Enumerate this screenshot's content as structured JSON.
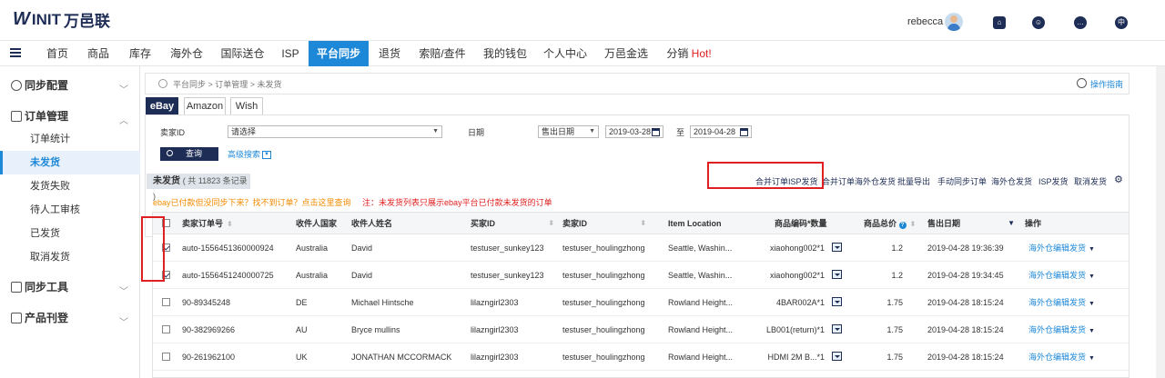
{
  "header": {
    "logo_mark": "W",
    "logo_text_en": "INIT",
    "logo_text_cn": "万邑联",
    "username": "rebecca"
  },
  "nav": {
    "items": [
      "首页",
      "商品",
      "库存",
      "海外仓",
      "国际送仓",
      "ISP",
      "平台同步",
      "退货",
      "索赔/查件",
      "我的钱包",
      "个人中心",
      "万邑金选",
      "分销"
    ],
    "hot": "Hot!",
    "active": "平台同步"
  },
  "sidebar": {
    "sync_config": "同步配置",
    "order_mgmt": "订单管理",
    "sub_items": [
      "订单统计",
      "未发货",
      "发货失败",
      "待人工审核",
      "已发货",
      "取消发货"
    ],
    "sync_tools": "同步工具",
    "product_listing": "产品刊登"
  },
  "breadcrumb": {
    "path": "平台同步 > 订单管理 > 未发货",
    "help": "操作指南"
  },
  "tabs": [
    "eBay",
    "Amazon",
    "Wish"
  ],
  "filter": {
    "seller_label": "卖家ID",
    "seller_value": "请选择",
    "date_label": "日期",
    "date_type": "售出日期",
    "date_from": "2019-03-28",
    "to": "至",
    "date_to": "2019-04-28",
    "query_button": "查询",
    "advanced": "高级搜索"
  },
  "list": {
    "tab_title": "未发货",
    "tab_count": "( 共 11823 条记录 )",
    "actions": [
      "合并订单ISP发货",
      "合并订单海外仓发货",
      "批量导出",
      "手动同步订单",
      "海外仓发货",
      "ISP发货",
      "取消发货"
    ],
    "note_orange": "ebay已付款但没同步下来？找不到订单？点击这里查询",
    "note_red": "注：未发货列表只展示ebay平台已付款未发货的订单"
  },
  "table": {
    "headers": [
      "卖家订单号",
      "收件人国家",
      "收件人姓名",
      "买家ID",
      "卖家ID",
      "Item Location",
      "商品编码*数量",
      "商品总价",
      "售出日期",
      "操作"
    ],
    "rows": [
      {
        "checked": true,
        "order": "auto-1556451360000924",
        "country": "Australia",
        "name": "David",
        "buyer": "testuser_sunkey123",
        "seller": "testuser_houlingzhong",
        "location": "Seattle, Washin...",
        "sku": "xiaohong002*1",
        "price": "1.2",
        "date": "2019-04-28 19:36:39",
        "op": "海外仓编辑发货"
      },
      {
        "checked": true,
        "order": "auto-1556451240000725",
        "country": "Australia",
        "name": "David",
        "buyer": "testuser_sunkey123",
        "seller": "testuser_houlingzhong",
        "location": "Seattle, Washin...",
        "sku": "xiaohong002*1",
        "price": "1.2",
        "date": "2019-04-28 19:34:45",
        "op": "海外仓编辑发货"
      },
      {
        "checked": false,
        "order": "90-89345248",
        "country": "DE",
        "name": "Michael Hintsche",
        "buyer": "lilazngirl2303",
        "seller": "testuser_houlingzhong",
        "location": "Rowland Height...",
        "sku": "4BAR002A*1",
        "price": "1.75",
        "date": "2019-04-28 18:15:24",
        "op": "海外仓编辑发货"
      },
      {
        "checked": false,
        "order": "90-382969266",
        "country": "AU",
        "name": "Bryce mullins",
        "buyer": "lilazngirl2303",
        "seller": "testuser_houlingzhong",
        "location": "Rowland Height...",
        "sku": "LB001(return)*1",
        "price": "1.75",
        "date": "2019-04-28 18:15:24",
        "op": "海外仓编辑发货"
      },
      {
        "checked": false,
        "order": "90-261962100",
        "country": "UK",
        "name": "JONATHAN MCCORMACK",
        "buyer": "lilazngirl2303",
        "seller": "testuser_houlingzhong",
        "location": "Rowland Height...",
        "sku": "HDMI 2M B...*1",
        "price": "1.75",
        "date": "2019-04-28 18:15:24",
        "op": "海外仓编辑发货"
      }
    ]
  }
}
